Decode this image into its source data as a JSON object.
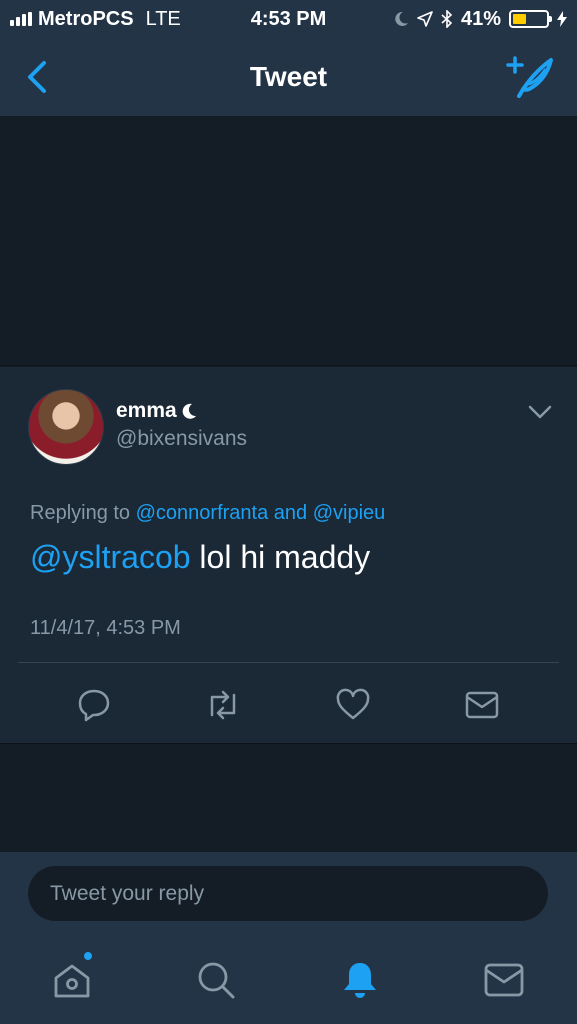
{
  "status_bar": {
    "carrier": "MetroPCS",
    "network": "LTE",
    "time": "4:53 PM",
    "battery_percent": "41%",
    "battery_level": 0.41,
    "battery_color": "#ffcc00"
  },
  "nav": {
    "title": "Tweet",
    "back_icon": "chevron-left-icon",
    "compose_icon": "compose-tweet-icon"
  },
  "tweet": {
    "display_name": "emma",
    "name_emoji": "moon-icon",
    "handle": "@bixensivans",
    "replying_prefix": "Replying to",
    "reply_user_1": "@connorfranta",
    "reply_and": "and",
    "reply_user_2": "@vipieu",
    "mention": "@ysltracob",
    "text": "lol hi maddy",
    "timestamp": "11/4/17, 4:53 PM"
  },
  "reply": {
    "placeholder": "Tweet your reply"
  },
  "colors": {
    "accent": "#1da1f2",
    "background": "#141d26",
    "card": "#1b2836",
    "bar": "#243447",
    "muted": "#8899a6"
  }
}
